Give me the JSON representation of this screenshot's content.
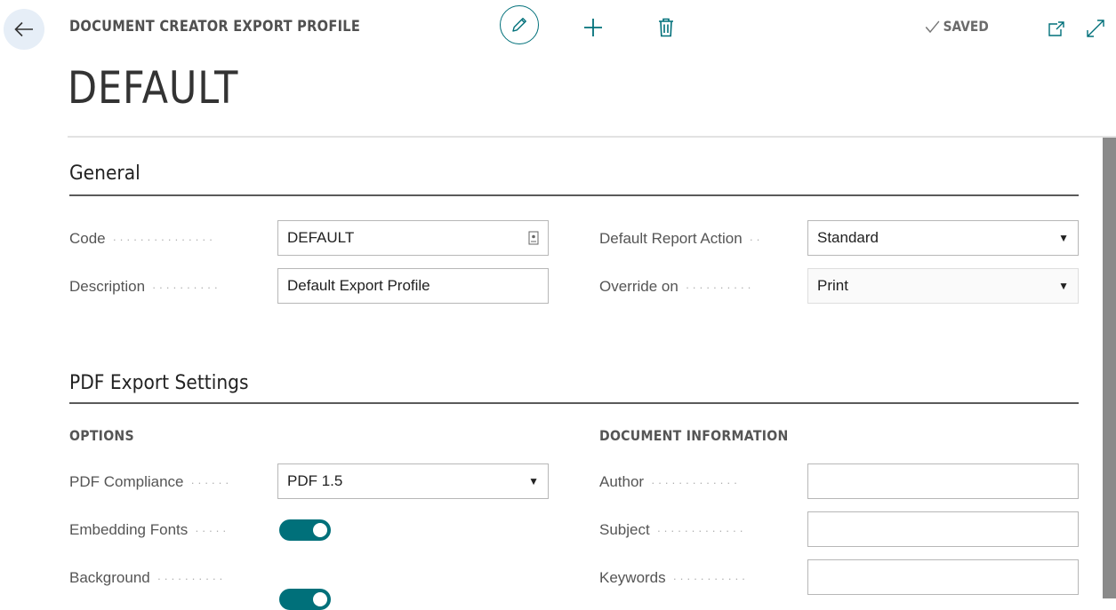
{
  "header": {
    "caption": "DOCUMENT CREATOR EXPORT PROFILE",
    "status": "SAVED",
    "title": "DEFAULT"
  },
  "icons": {
    "back": "back-arrow-icon",
    "edit": "pencil-icon",
    "new": "plus-icon",
    "delete": "trash-icon",
    "saved": "checkmark-icon",
    "open_new_window": "open-in-new-window-icon",
    "expand": "expand-icon",
    "lookup": "lookup-icon"
  },
  "colors": {
    "accent": "#00707a",
    "back_button_bg": "#e6eef7"
  },
  "general": {
    "title": "General",
    "fields": {
      "code": {
        "label": "Code",
        "value": "DEFAULT"
      },
      "description": {
        "label": "Description",
        "value": "Default Export Profile"
      },
      "default_report_action": {
        "label": "Default Report Action",
        "value": "Standard"
      },
      "override_on": {
        "label": "Override on",
        "value": "Print"
      }
    }
  },
  "pdf": {
    "title": "PDF Export Settings",
    "options": {
      "caption": "OPTIONS",
      "pdf_compliance": {
        "label": "PDF Compliance",
        "value": "PDF 1.5"
      },
      "embedding_fonts": {
        "label": "Embedding Fonts",
        "value": true
      },
      "background": {
        "label": "Background",
        "value": true
      }
    },
    "document_information": {
      "caption": "DOCUMENT INFORMATION",
      "author": {
        "label": "Author",
        "value": ""
      },
      "subject": {
        "label": "Subject",
        "value": ""
      },
      "keywords": {
        "label": "Keywords",
        "value": ""
      }
    }
  }
}
